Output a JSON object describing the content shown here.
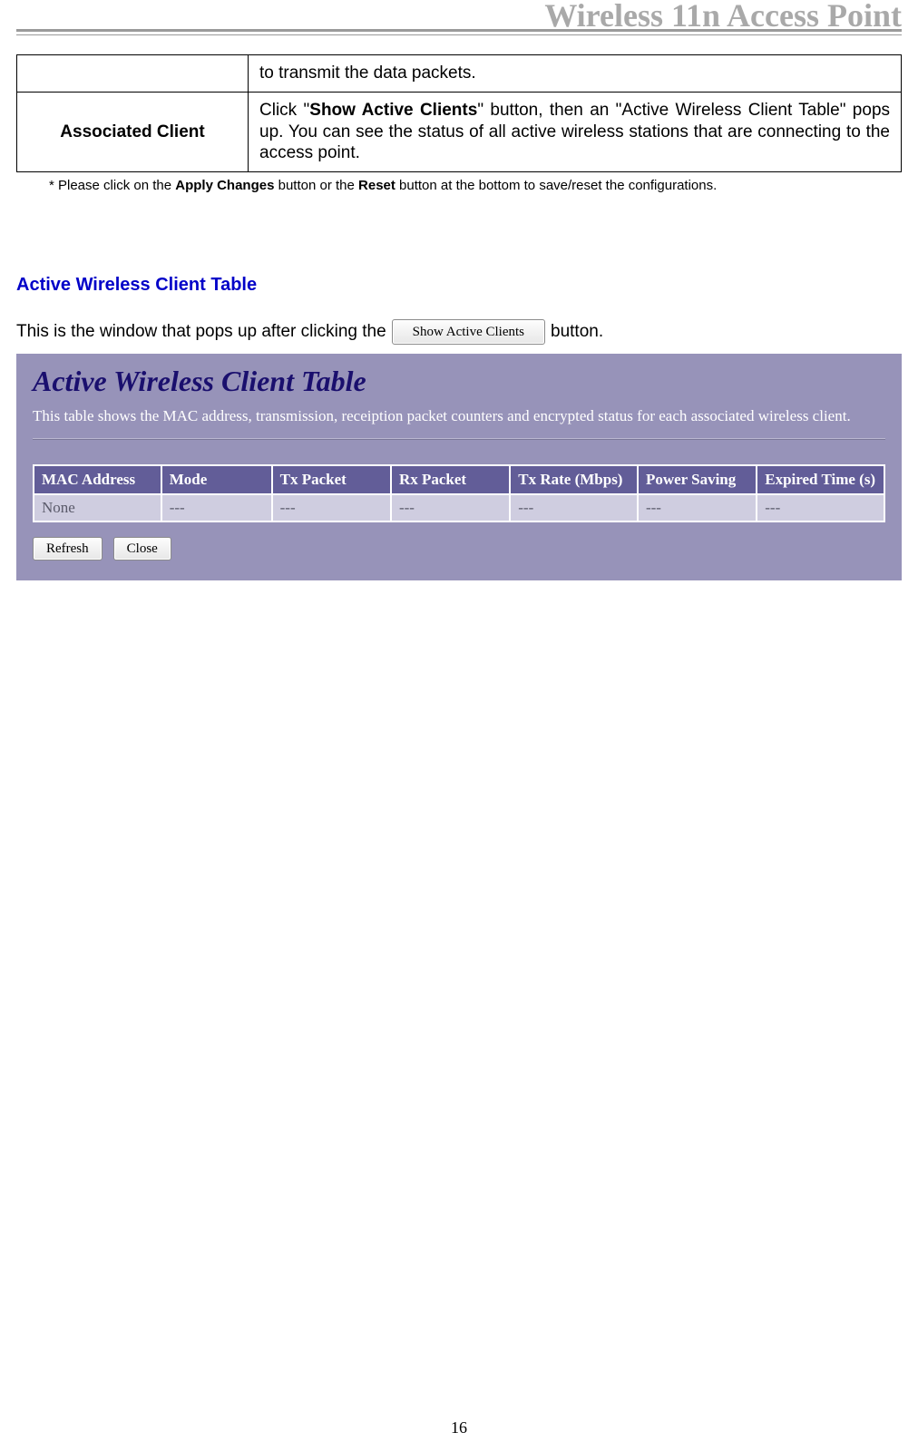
{
  "header": {
    "title": "Wireless 11n Access Point"
  },
  "defTable": {
    "row1": {
      "label": "",
      "desc": "to transmit the data packets."
    },
    "row2": {
      "label": "Associated Client",
      "desc_pre": "Click \"",
      "desc_bold": "Show Active Clients",
      "desc_post": "\" button, then an \"Active Wireless Client Table\" pops up. You can see the status of all active wireless stations that are connecting to the access point."
    }
  },
  "footnote": {
    "pre": "* Please click on the ",
    "b1": "Apply Changes",
    "mid": " button or the ",
    "b2": "Reset",
    "post": " button at the bottom to save/reset the configurations."
  },
  "section": {
    "heading": "Active Wireless Client Table"
  },
  "intro": {
    "pre": "This is the window that pops up after clicking the",
    "btn": "Show Active Clients",
    "post": " button."
  },
  "popup": {
    "title": "Active Wireless Client Table",
    "desc": "This table shows the MAC address, transmission, receiption packet counters and encrypted status for each associated wireless client.",
    "headers": [
      "MAC Address",
      "Mode",
      "Tx Packet",
      "Rx Packet",
      "Tx Rate (Mbps)",
      "Power Saving",
      "Expired Time (s)"
    ],
    "row": [
      "None",
      "---",
      "---",
      "---",
      "---",
      "---",
      "---"
    ],
    "buttons": {
      "refresh": "Refresh",
      "close": "Close"
    }
  },
  "pageNumber": "16",
  "chart_data": {
    "type": "table",
    "title": "Active Wireless Client Table",
    "columns": [
      "MAC Address",
      "Mode",
      "Tx Packet",
      "Rx Packet",
      "Tx Rate (Mbps)",
      "Power Saving",
      "Expired Time (s)"
    ],
    "rows": [
      [
        "None",
        "---",
        "---",
        "---",
        "---",
        "---",
        "---"
      ]
    ]
  }
}
